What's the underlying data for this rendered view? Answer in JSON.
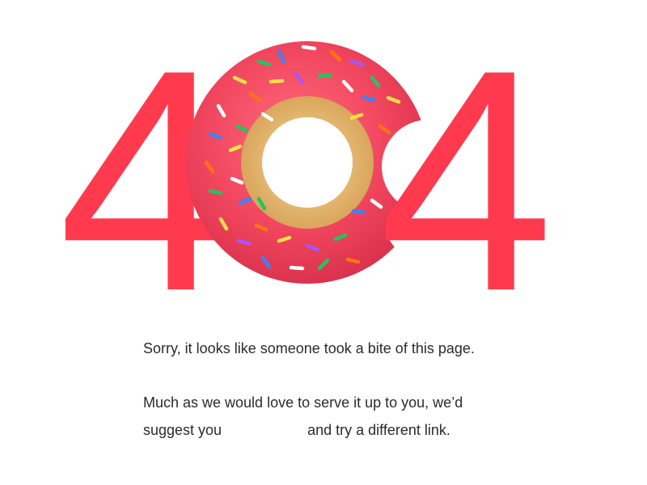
{
  "hero": {
    "digit_left": "4",
    "digit_right": "4",
    "digit_color": "#ff3a4f"
  },
  "message": {
    "line1": "Sorry, it looks like someone took a bite of this page.",
    "line2": "Much as we would love to serve it up to you, we’d",
    "line3_before": "suggest you",
    "link_text": "",
    "line3_after": "and try a different link."
  },
  "icons": {
    "donut": "donut-icon"
  }
}
